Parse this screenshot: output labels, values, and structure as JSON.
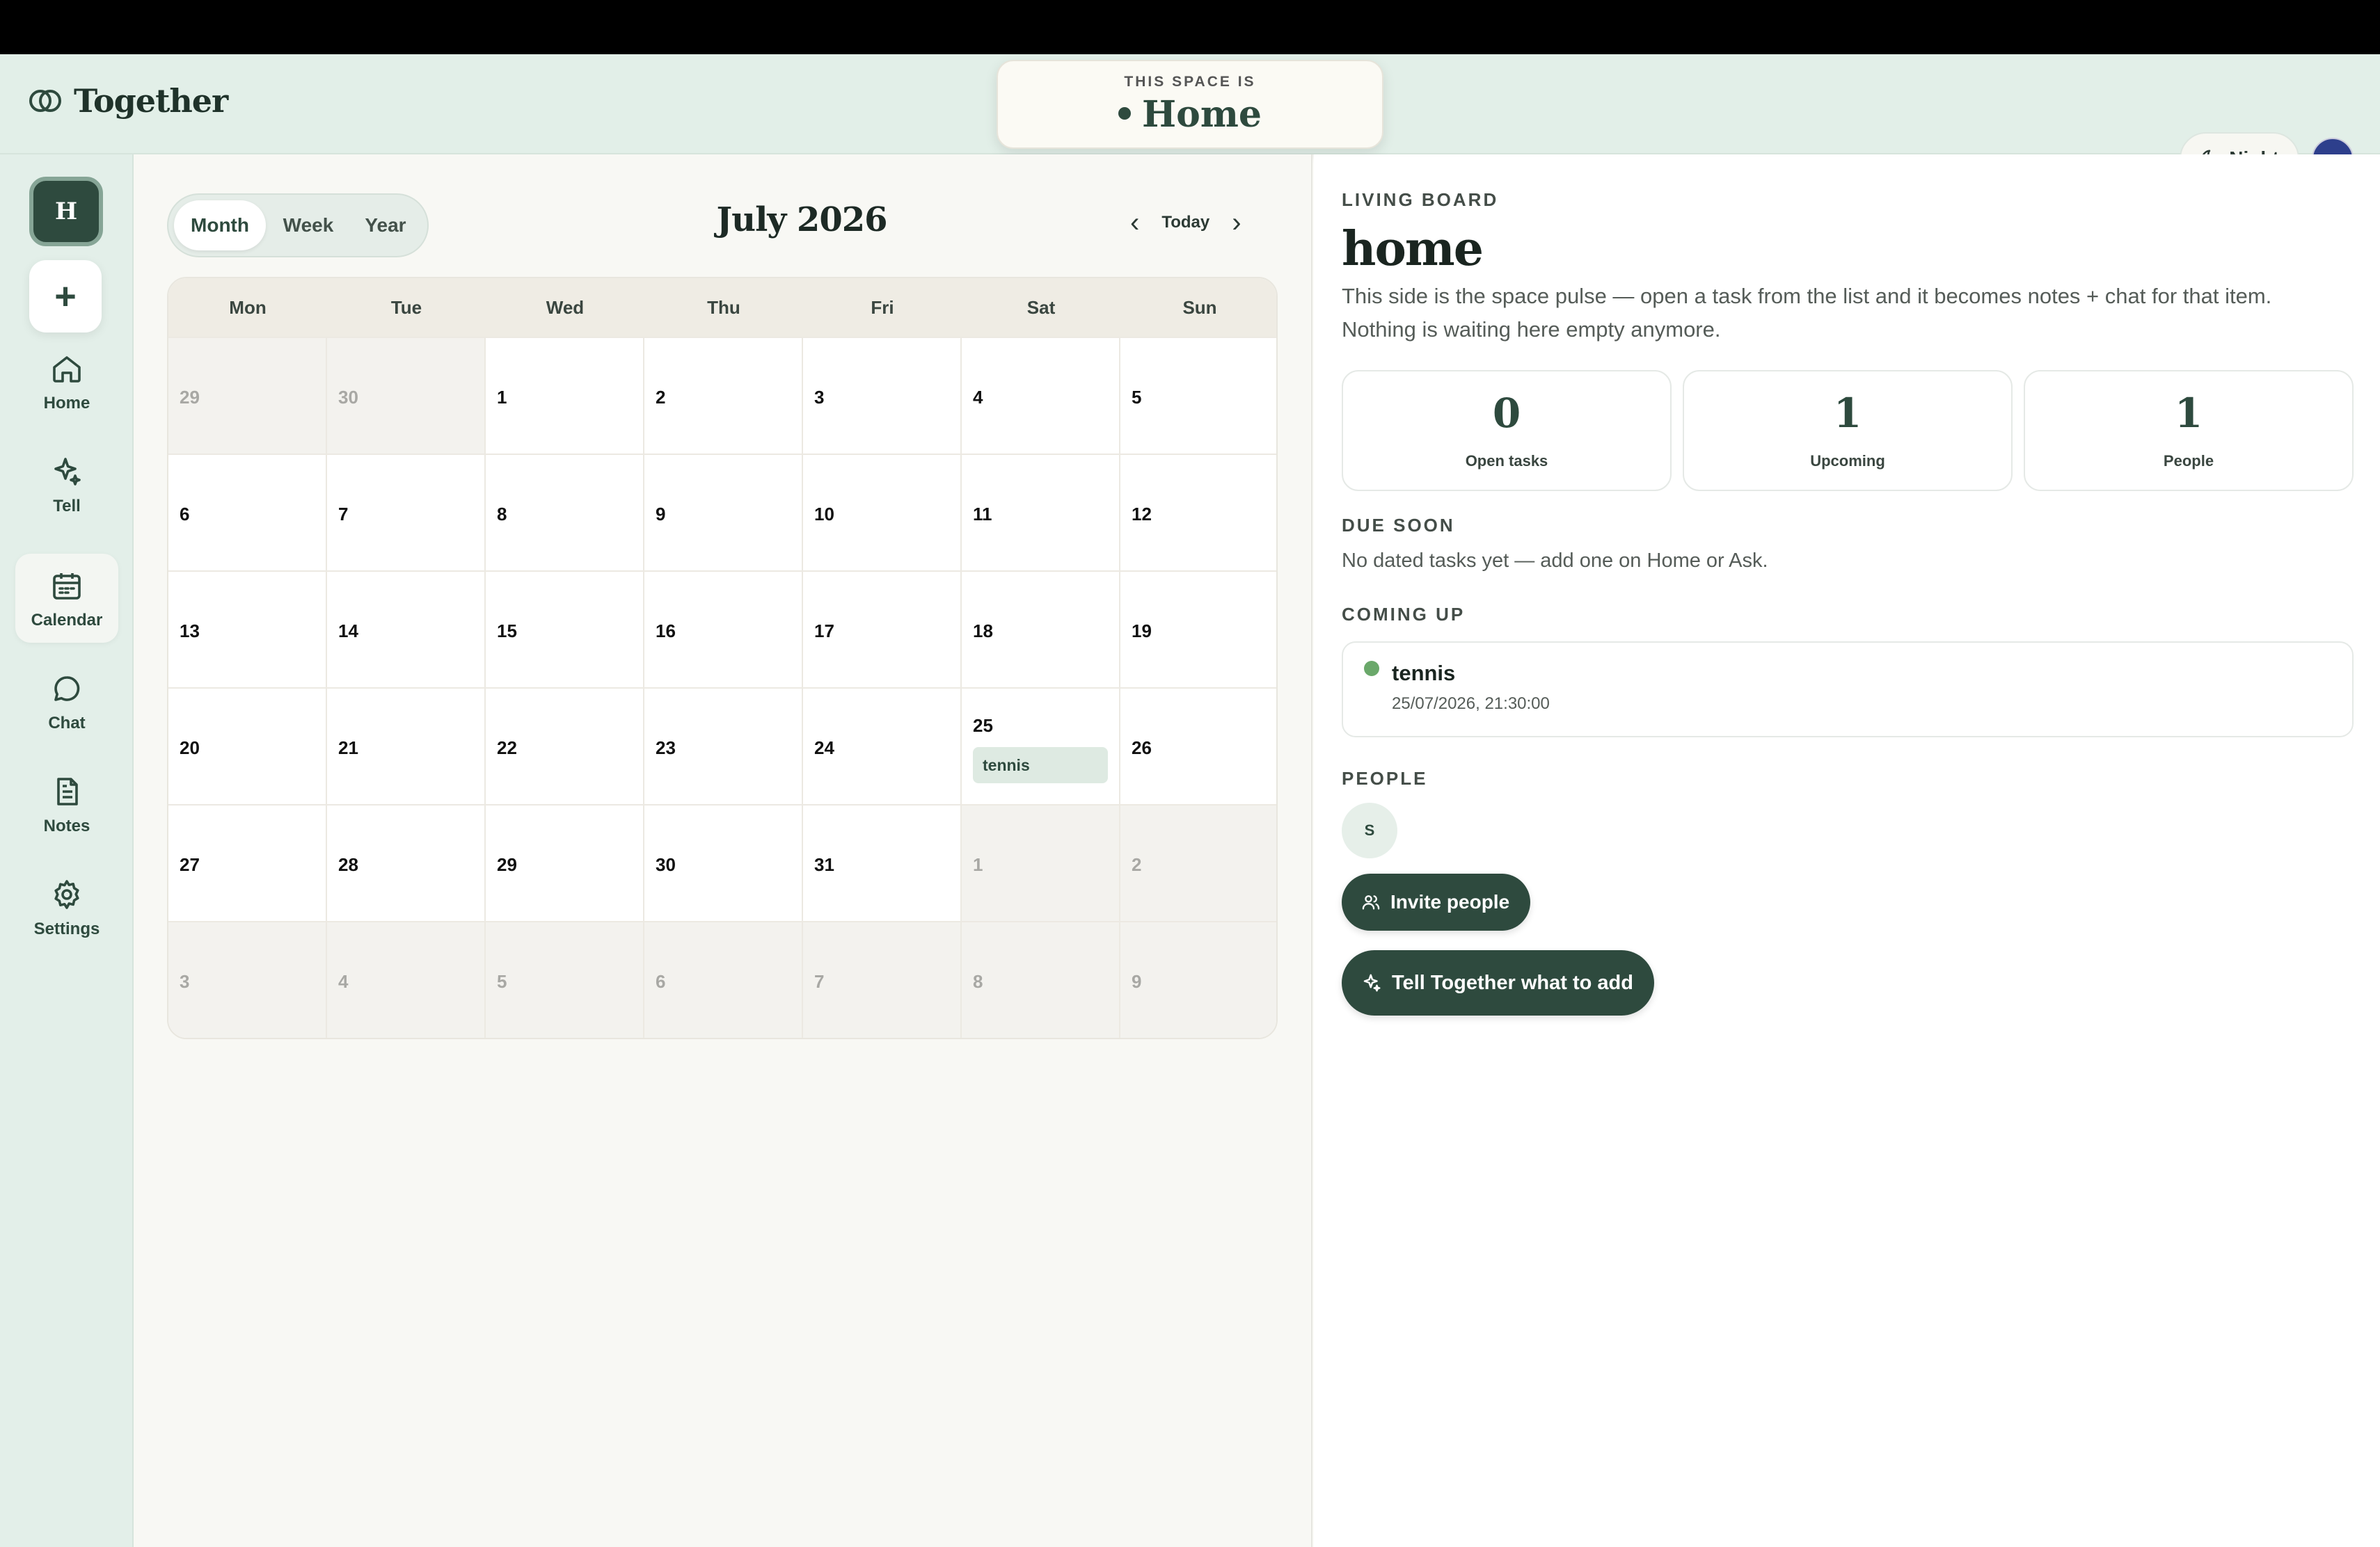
{
  "app": {
    "name": "Together"
  },
  "space_card": {
    "label": "THIS SPACE IS",
    "name": "Home"
  },
  "header": {
    "night_label": "Night"
  },
  "sidebar": {
    "space_initial": "H",
    "add_label": "+",
    "items": [
      {
        "label": "Home",
        "icon": "home-icon"
      },
      {
        "label": "Tell",
        "icon": "sparkle-icon"
      },
      {
        "label": "Calendar",
        "icon": "calendar-icon",
        "active": true
      },
      {
        "label": "Chat",
        "icon": "chat-icon"
      },
      {
        "label": "Notes",
        "icon": "notes-icon"
      },
      {
        "label": "Settings",
        "icon": "gear-icon"
      }
    ]
  },
  "calendar": {
    "views": [
      "Month",
      "Week",
      "Year"
    ],
    "active_view": "Month",
    "title": "July 2026",
    "today_label": "Today",
    "weekdays": [
      "Mon",
      "Tue",
      "Wed",
      "Thu",
      "Fri",
      "Sat",
      "Sun"
    ],
    "days": [
      [
        "29",
        "30",
        "1",
        "2",
        "3",
        "4",
        "5"
      ],
      [
        "6",
        "7",
        "8",
        "9",
        "10",
        "11",
        "12"
      ],
      [
        "13",
        "14",
        "15",
        "16",
        "17",
        "18",
        "19"
      ],
      [
        "20",
        "21",
        "22",
        "23",
        "24",
        "25",
        "26"
      ],
      [
        "27",
        "28",
        "29",
        "30",
        "31",
        "1",
        "2"
      ],
      [
        "3",
        "4",
        "5",
        "6",
        "7",
        "8",
        "9"
      ]
    ],
    "event": {
      "day": "25",
      "title": "tennis"
    }
  },
  "board": {
    "kicker": "LIVING BOARD",
    "title": "home",
    "description": "This side is the space pulse — open a task from the list and it becomes notes + chat for that item. Nothing is waiting here empty anymore.",
    "stats": [
      {
        "value": "0",
        "label": "Open tasks"
      },
      {
        "value": "1",
        "label": "Upcoming"
      },
      {
        "value": "1",
        "label": "People"
      }
    ],
    "due_soon_label": "DUE SOON",
    "due_soon_text": "No dated tasks yet — add one on Home or Ask.",
    "coming_up_label": "COMING UP",
    "coming_up": {
      "title": "tennis",
      "date": "25/07/2026, 21:30:00"
    },
    "people_label": "PEOPLE",
    "person_initial": "S",
    "invite_label": "Invite people",
    "tell_label": "Tell Together what to add"
  },
  "colors": {
    "accent": "#2e4a3e",
    "event_dot": "#6aa86a",
    "chip_bg": "#deeae2"
  }
}
